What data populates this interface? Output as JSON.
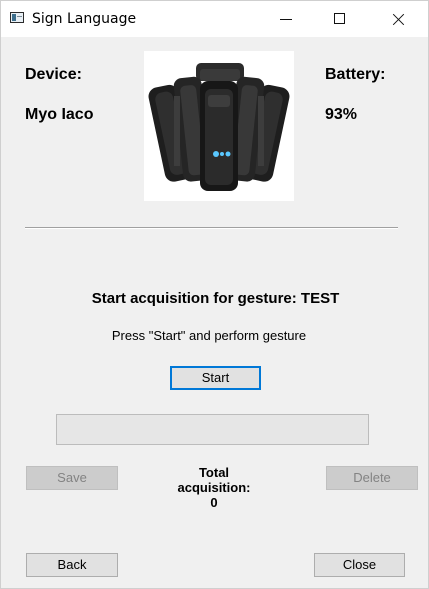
{
  "window": {
    "title": "Sign Language",
    "icon": "window-app-icon",
    "controls": {
      "minimize": "minimize-icon",
      "maximize": "maximize-icon",
      "close": "close-icon"
    }
  },
  "device": {
    "label": "Device:",
    "name": "Myo Iaco",
    "image": "myo-armband-image"
  },
  "battery": {
    "label": "Battery:",
    "value": "93%"
  },
  "acquisition": {
    "heading": "Start acquisition for gesture: TEST",
    "instruction": "Press \"Start\" and perform gesture",
    "start_label": "Start",
    "progress": 0,
    "save_label": "Save",
    "delete_label": "Delete",
    "total_label_line1": "Total",
    "total_label_line2": "acquisition:",
    "total_count": "0"
  },
  "footer": {
    "back_label": "Back",
    "close_label": "Close"
  },
  "colors": {
    "window_bg": "#f0f0f0",
    "focus_border": "#0078d7",
    "button_bg": "#e1e1e1",
    "disabled_button_bg": "#cccccc",
    "progress_fill": "#06b025"
  }
}
